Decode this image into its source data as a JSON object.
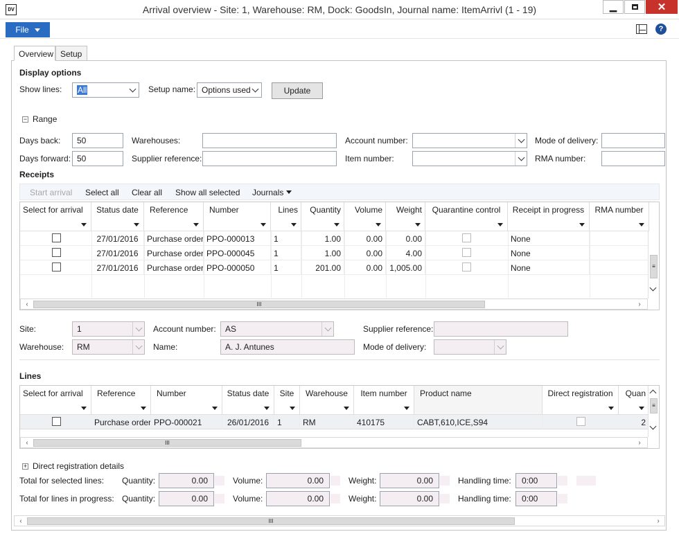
{
  "window": {
    "title": "Arrival overview - Site: 1, Warehouse: RM, Dock: GoodsIn, Journal name: ItemArrivl (1 - 19)",
    "app_icon": "DV"
  },
  "menu": {
    "file_label": "File"
  },
  "tabs": [
    {
      "label": "Overview"
    },
    {
      "label": "Setup"
    }
  ],
  "display_options": {
    "title": "Display options",
    "show_lines_label": "Show lines:",
    "show_lines_value": "All",
    "setup_name_label": "Setup name:",
    "setup_name_value": "Options used",
    "update_label": "Update"
  },
  "range": {
    "title": "Range",
    "days_back_label": "Days back:",
    "days_back_value": "50",
    "days_forward_label": "Days forward:",
    "days_forward_value": "50",
    "warehouses_label": "Warehouses:",
    "supplier_reference_label": "Supplier reference:",
    "account_number_label": "Account number:",
    "item_number_label": "Item number:",
    "mode_of_delivery_label": "Mode of delivery:",
    "rma_number_label": "RMA number:"
  },
  "receipts": {
    "title": "Receipts",
    "toolbar": {
      "start_arrival": "Start arrival",
      "select_all": "Select all",
      "clear_all": "Clear all",
      "show_all_selected": "Show all selected",
      "journals": "Journals"
    },
    "columns": [
      "Select for arrival",
      "Status date",
      "Reference",
      "Number",
      "Lines",
      "Quantity",
      "Volume",
      "Weight",
      "Quarantine control",
      "Receipt in progress",
      "RMA number"
    ],
    "rows": [
      {
        "status_date": "27/01/2016",
        "reference": "Purchase order",
        "number": "PPO-000013",
        "lines": "1",
        "quantity": "1.00",
        "volume": "0.00",
        "weight": "0.00",
        "receipt_in_progress": "None"
      },
      {
        "status_date": "27/01/2016",
        "reference": "Purchase order",
        "number": "PPO-000045",
        "lines": "1",
        "quantity": "1.00",
        "volume": "0.00",
        "weight": "4.00",
        "receipt_in_progress": "None"
      },
      {
        "status_date": "27/01/2016",
        "reference": "Purchase order",
        "number": "PPO-000050",
        "lines": "1",
        "quantity": "201.00",
        "volume": "0.00",
        "weight": "1,005.00",
        "receipt_in_progress": "None"
      }
    ]
  },
  "details": {
    "site_label": "Site:",
    "site_value": "1",
    "warehouse_label": "Warehouse:",
    "warehouse_value": "RM",
    "account_number_label": "Account number:",
    "account_number_value": "AS",
    "name_label": "Name:",
    "name_value": "A. J. Antunes",
    "supplier_reference_label": "Supplier reference:",
    "mode_of_delivery_label": "Mode of delivery:"
  },
  "lines": {
    "title": "Lines",
    "columns": [
      "Select for arrival",
      "Reference",
      "Number",
      "Status date",
      "Site",
      "Warehouse",
      "Item number",
      "Product name",
      "Direct registration",
      "Quan"
    ],
    "rows": [
      {
        "reference": "Purchase order",
        "number": "PPO-000021",
        "status_date": "26/01/2016",
        "site": "1",
        "warehouse": "RM",
        "item_number": "410175",
        "product_name": "CABT,610,ICE,S94",
        "quantity": "2"
      }
    ]
  },
  "direct_registration": {
    "title": "Direct registration details",
    "selected_label": "Total for selected lines:",
    "progress_label": "Total for lines in progress:",
    "quantity_label": "Quantity:",
    "volume_label": "Volume:",
    "weight_label": "Weight:",
    "handling_label": "Handling time:",
    "selected": {
      "quantity": "0.00",
      "volume": "0.00",
      "weight": "0.00",
      "handling": "0:00"
    },
    "progress": {
      "quantity": "0.00",
      "volume": "0.00",
      "weight": "0.00",
      "handling": "0:00"
    }
  },
  "scroll_grip": "III"
}
